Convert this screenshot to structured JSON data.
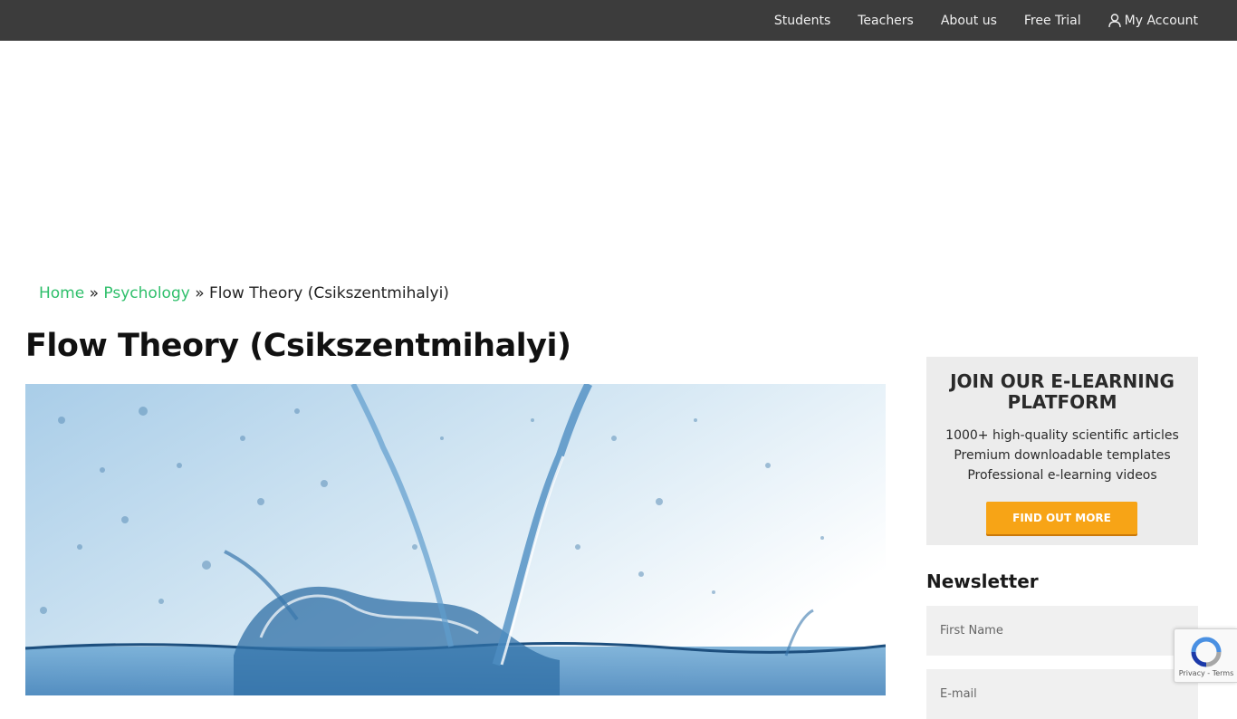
{
  "nav": {
    "items": [
      {
        "label": "Students"
      },
      {
        "label": "Teachers"
      },
      {
        "label": "About us"
      },
      {
        "label": "Free Trial"
      },
      {
        "label": "My Account",
        "icon": "user-icon"
      }
    ]
  },
  "breadcrumb": {
    "home": "Home",
    "separator": "»",
    "category": "Psychology",
    "current": "Flow Theory (Csikszentmihalyi)"
  },
  "article": {
    "title": "Flow Theory (Csikszentmihalyi)"
  },
  "promo": {
    "heading_line1": "JOIN OUR E-LEARNING",
    "heading_line2": "PLATFORM",
    "line1": "1000+ high-quality scientific articles",
    "line2": "Premium downloadable templates",
    "line3": "Professional e-learning videos",
    "button": "FIND OUT MORE",
    "button_color": "#f7a416"
  },
  "newsletter": {
    "title": "Newsletter",
    "first_name_placeholder": "First Name",
    "email_placeholder": "E-mail"
  },
  "recaptcha": {
    "links": "Privacy - Terms"
  },
  "colors": {
    "topbar": "#3c3c3c",
    "link_green": "#2fbf6b"
  }
}
